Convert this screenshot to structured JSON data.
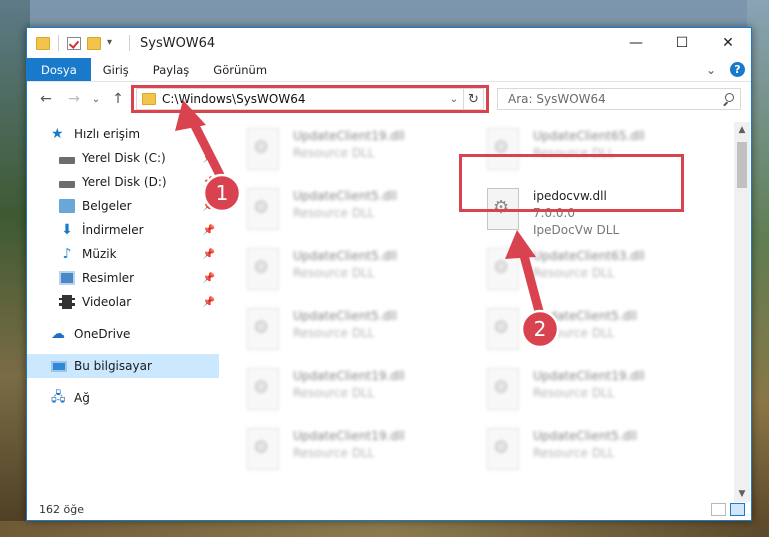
{
  "window": {
    "title": "SysWOW64",
    "controls": {
      "minimize": "—",
      "maximize": "☐",
      "close": "✕"
    }
  },
  "ribbon": {
    "tabs": [
      "Dosya",
      "Giriş",
      "Paylaş",
      "Görünüm"
    ],
    "expand": "⌄",
    "help": "?"
  },
  "nav": {
    "back": "←",
    "forward": "→",
    "recent": "⌄",
    "up": "↑",
    "address": "C:\\Windows\\SysWOW64",
    "address_dropdown": "⌄",
    "refresh": "↻",
    "search_placeholder": "Ara: SysWOW64"
  },
  "sidebar": {
    "quick_access": "Hızlı erişim",
    "items": [
      {
        "label": "Yerel Disk (C:)",
        "icon": "disk-icon",
        "pinned": true
      },
      {
        "label": "Yerel Disk (D:)",
        "icon": "disk-icon",
        "pinned": true
      },
      {
        "label": "Belgeler",
        "icon": "documents-icon",
        "pinned": true
      },
      {
        "label": "İndirmeler",
        "icon": "downloads-icon",
        "pinned": true
      },
      {
        "label": "Müzik",
        "icon": "music-icon",
        "pinned": true
      },
      {
        "label": "Resimler",
        "icon": "pictures-icon",
        "pinned": true
      },
      {
        "label": "Videolar",
        "icon": "videos-icon",
        "pinned": true
      }
    ],
    "onedrive": "OneDrive",
    "this_pc": "Bu bilgisayar",
    "network": "Ağ"
  },
  "files": {
    "left_column": [
      {
        "name": "UpdateClient19.dll",
        "type": "Resource DLL"
      },
      {
        "name": "UpdateClient5.dll",
        "type": "Resource DLL"
      },
      {
        "name": "UpdateClient5.dll",
        "type": "Resource DLL"
      },
      {
        "name": "UpdateClient5.dll",
        "type": "Resource DLL"
      },
      {
        "name": "UpdateClient19.dll",
        "type": "Resource DLL"
      },
      {
        "name": "UpdateClient19.dll",
        "type": "Resource DLL"
      }
    ],
    "right_column": [
      {
        "name": "UpdateClient65.dll",
        "type": "Resource DLL"
      },
      {
        "name": "UpdateClient63.dll",
        "type": "Resource DLL"
      },
      {
        "name": "UpdateClient5.dll",
        "type": "Resource DLL"
      },
      {
        "name": "UpdateClient19.dll",
        "type": "Resource DLL"
      },
      {
        "name": "UpdateClient5.dll",
        "type": "Resource DLL"
      }
    ],
    "highlighted": {
      "name": "ipedocvw.dll",
      "version": "7.0.0.0",
      "description": "IpeDocVw DLL"
    }
  },
  "status": {
    "item_count": "162 öğe"
  },
  "annotations": {
    "step1": "1",
    "step2": "2",
    "color": "#d9424f"
  },
  "colors": {
    "accent": "#1979ca",
    "highlight": "#d9424f"
  }
}
